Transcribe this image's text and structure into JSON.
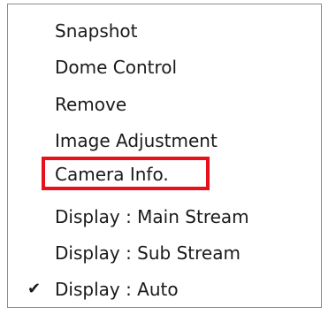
{
  "menu": {
    "items": [
      {
        "label": "Snapshot",
        "checked": false
      },
      {
        "label": "Dome Control",
        "checked": false
      },
      {
        "label": "Remove",
        "checked": false
      },
      {
        "label": "Image Adjustment",
        "checked": false
      },
      {
        "label": "Camera Info.",
        "checked": false,
        "highlighted": true
      },
      {
        "label": "Display : Main Stream",
        "checked": false
      },
      {
        "label": "Display : Sub Stream",
        "checked": false
      },
      {
        "label": "Display : Auto",
        "checked": true
      }
    ],
    "check_glyph": "✔",
    "highlight_color": "#e8101c"
  }
}
